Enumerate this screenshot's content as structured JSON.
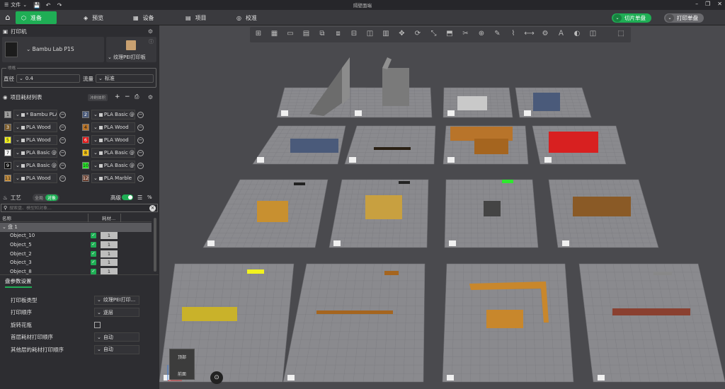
{
  "titlebar": {
    "file_menu": "文件",
    "app_title": "隔壁面端"
  },
  "nav": {
    "tabs": [
      {
        "label": "准备",
        "active": true
      },
      {
        "label": "预览",
        "active": false
      },
      {
        "label": "设备",
        "active": false
      },
      {
        "label": "项目",
        "active": false
      },
      {
        "label": "校准",
        "active": false
      }
    ],
    "slice_button": "切片单盘",
    "print_button": "打印单盘",
    "accent_color": "#1fae55"
  },
  "printer_section": {
    "title": "打印机",
    "printer_name": "Bambu Lab P1S",
    "plate_name": "纹理PEI打印板",
    "nozzle": {
      "legend": "喷嘴",
      "diameter_label": "直径",
      "diameter_value": "0.4",
      "flow_label": "流量",
      "flow_value": "标准"
    }
  },
  "filament_section": {
    "title": "项目耗材列表",
    "flush_button": "冲刷体积",
    "filaments": [
      {
        "num": "1",
        "name": "* Bambu PLA Ba...",
        "color": "#9e9e9e"
      },
      {
        "num": "2",
        "name": "PLA Basic @...",
        "color": "#4a5a7a"
      },
      {
        "num": "3",
        "name": "PLA Wood",
        "color": "#7a5a2a"
      },
      {
        "num": "4",
        "name": "PLA Wood",
        "color": "#b8742a"
      },
      {
        "num": "5",
        "name": "PLA Wood",
        "color": "#f2f21e"
      },
      {
        "num": "6",
        "name": "PLA Wood",
        "color": "#e01a1a"
      },
      {
        "num": "7",
        "name": "PLA Basic @...",
        "color": "#f5f5f5"
      },
      {
        "num": "8",
        "name": "PLA Basic @...",
        "color": "#f5c518"
      },
      {
        "num": "9",
        "name": "PLA Basic @...",
        "color": "#111111"
      },
      {
        "num": "10",
        "name": "PLA Basic @...",
        "color": "#2ee82e"
      },
      {
        "num": "11",
        "name": "PLA Wood",
        "color": "#c89040"
      },
      {
        "num": "12",
        "name": "PLA Marble",
        "color": "#6a4030"
      }
    ]
  },
  "process_section": {
    "title": "工艺",
    "toggle_global": "全局",
    "toggle_object": "对象",
    "advanced_label": "高级",
    "search_placeholder": "搜索盘、模型和对象...",
    "col_name": "名称",
    "col_filament": "耗材...",
    "plate_label": "盘 1",
    "objects": [
      {
        "name": "Object_10",
        "count": "1"
      },
      {
        "name": "Object_5",
        "count": "1"
      },
      {
        "name": "Object_2",
        "count": "1"
      },
      {
        "name": "Object_3",
        "count": "1"
      },
      {
        "name": "Object_8",
        "count": "1"
      }
    ]
  },
  "plate_settings": {
    "title": "盘参数设置",
    "rows": [
      {
        "label": "打印板类型",
        "value": "纹理PEI打印..."
      },
      {
        "label": "打印顺序",
        "value": "逐层"
      },
      {
        "label": "旋转花瓶",
        "value": ""
      },
      {
        "label": "首层耗材打印顺序",
        "value": "自动"
      },
      {
        "label": "其他层的耗材打印顺序",
        "value": "自动"
      }
    ]
  },
  "viewport": {
    "view_cube_top": "顶部",
    "view_cube_front": "前面"
  }
}
